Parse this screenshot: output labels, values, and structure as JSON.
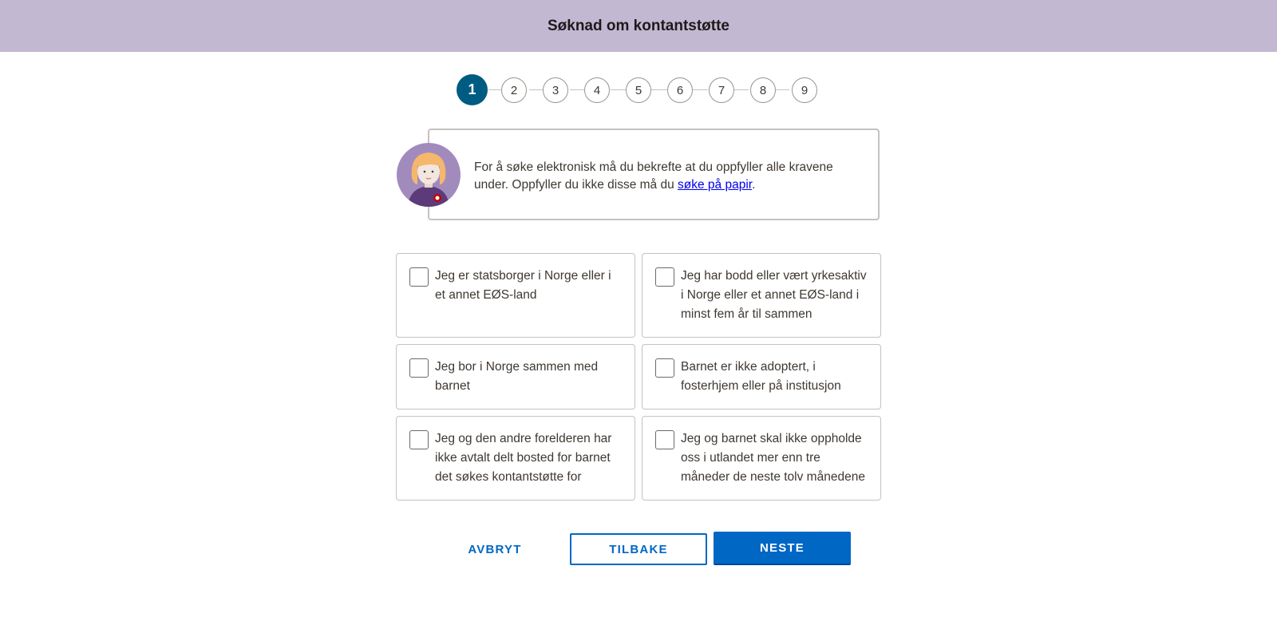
{
  "header": {
    "title": "Søknad om kontantstøtte"
  },
  "stepper": {
    "steps": [
      "1",
      "2",
      "3",
      "4",
      "5",
      "6",
      "7",
      "8",
      "9"
    ],
    "active": "1"
  },
  "guide": {
    "text": "For å søke elektronisk må du bekrefte at du oppfyller alle kravene under. Oppfyller du ikke disse må du ",
    "link": "søke på papir",
    "suffix": "."
  },
  "requirements": [
    {
      "label": "Jeg er statsborger i Norge eller i et annet EØS-land",
      "checked": false
    },
    {
      "label": "Jeg har bodd eller vært yrkesaktiv i Norge eller et annet EØS-land i minst fem år til sammen",
      "checked": false
    },
    {
      "label": "Jeg bor i Norge sammen med barnet",
      "checked": false
    },
    {
      "label": "Barnet er ikke adoptert, i fosterhjem eller på institusjon",
      "checked": false
    },
    {
      "label": "Jeg og den andre forelderen har ikke avtalt delt bosted for barnet det søkes kontantstøtte for",
      "checked": false
    },
    {
      "label": "Jeg og barnet skal ikke oppholde oss i utlandet mer enn tre måneder de neste tolv månedene",
      "checked": false
    }
  ],
  "buttons": {
    "cancel": "AVBRYT",
    "back": "TILBAKE",
    "next": "NESTE"
  },
  "colors": {
    "header_bg": "#c3b8d1",
    "active_step": "#005b82",
    "primary": "#0067c5"
  }
}
